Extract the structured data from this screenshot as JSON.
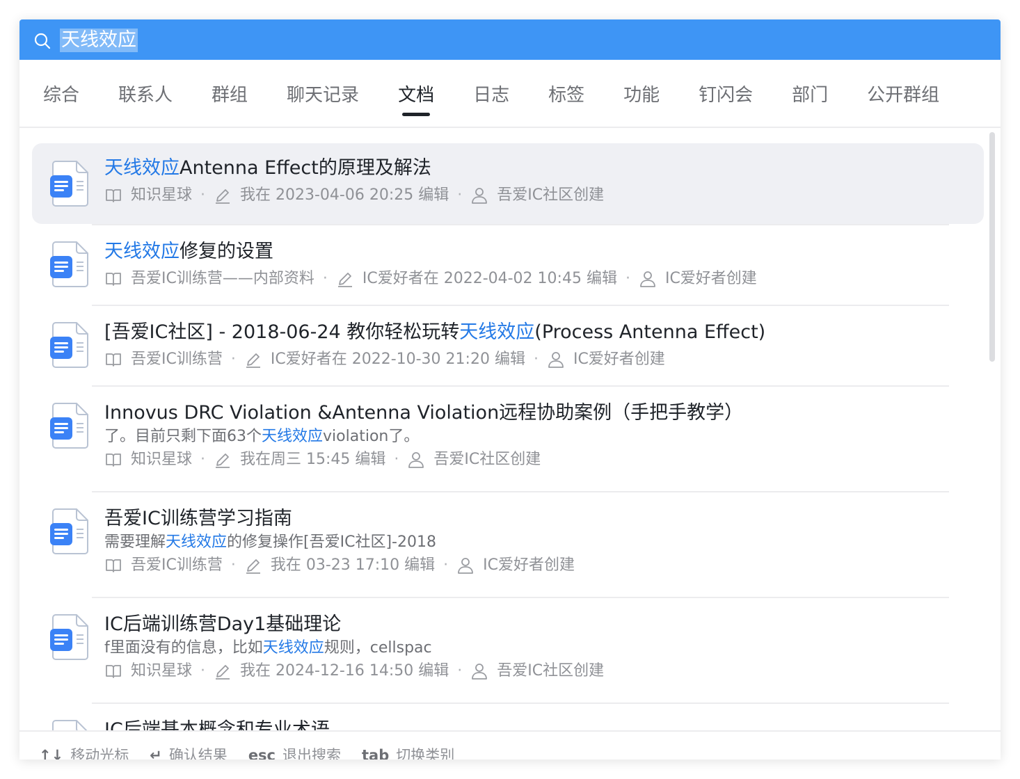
{
  "search": {
    "query": "天线效应",
    "placeholder": ""
  },
  "tabs": [
    {
      "label": "综合"
    },
    {
      "label": "联系人"
    },
    {
      "label": "群组"
    },
    {
      "label": "聊天记录"
    },
    {
      "label": "文档",
      "active": true
    },
    {
      "label": "日志"
    },
    {
      "label": "标签"
    },
    {
      "label": "功能"
    },
    {
      "label": "钉闪会"
    },
    {
      "label": "部门"
    },
    {
      "label": "公开群组"
    }
  ],
  "results": [
    {
      "title_hl": "天线效应",
      "title_rest": "Antenna Effect的原理及解法",
      "space": "知识星球",
      "edited": "我在 2023-04-06 20:25 编辑",
      "creator": "吾爱IC社区创建"
    },
    {
      "title_hl": "天线效应",
      "title_rest": "修复的设置",
      "space": "吾爱IC训练营——内部资料",
      "edited": "IC爱好者在 2022-04-02 10:45 编辑",
      "creator": "IC爱好者创建"
    },
    {
      "title_pre": "[吾爱IC社区] - 2018-06-24 教你轻松玩转",
      "title_hl": "天线效应",
      "title_post": "(Process Antenna Effect)",
      "space": "吾爱IC训练营",
      "edited": "IC爱好者在 2022-10-30 21:20 编辑",
      "creator": "IC爱好者创建"
    },
    {
      "title": "Innovus DRC Violation &Antenna Violation远程协助案例（手把手教学）",
      "snippet_pre": "了。目前只剩下面63个",
      "snippet_hl": "天线效应",
      "snippet_post": "violation了。",
      "space": "知识星球",
      "edited": "我在周三 15:45 编辑",
      "creator": "吾爱IC社区创建"
    },
    {
      "title": "吾爱IC训练营学习指南",
      "snippet_pre": "需要理解",
      "snippet_hl": "天线效应",
      "snippet_post": "的修复操作[吾爱IC社区]-2018",
      "space": "吾爱IC训练营",
      "edited": "我在 03-23 17:10 编辑",
      "creator": "IC爱好者创建"
    },
    {
      "title": "IC后端训练营Day1基础理论",
      "snippet_pre": "f里面没有的信息，比如",
      "snippet_hl": "天线效应",
      "snippet_post": "规则，cellspac",
      "space": "知识星球",
      "edited": "我在 2024-12-16 14:50 编辑",
      "creator": "吾爱IC社区创建"
    },
    {
      "title": "IC后端基本概念和专业术语"
    }
  ],
  "footer": {
    "move_key": "↑↓",
    "move_label": "移动光标",
    "confirm_key": "↵",
    "confirm_label": "确认结果",
    "esc_key": "esc",
    "esc_label": "退出搜索",
    "tab_key": "tab",
    "tab_label": "切换类别"
  },
  "colors": {
    "accent": "#3e95f5",
    "highlight": "#2379e6",
    "doc_icon": "#3b82f6"
  }
}
